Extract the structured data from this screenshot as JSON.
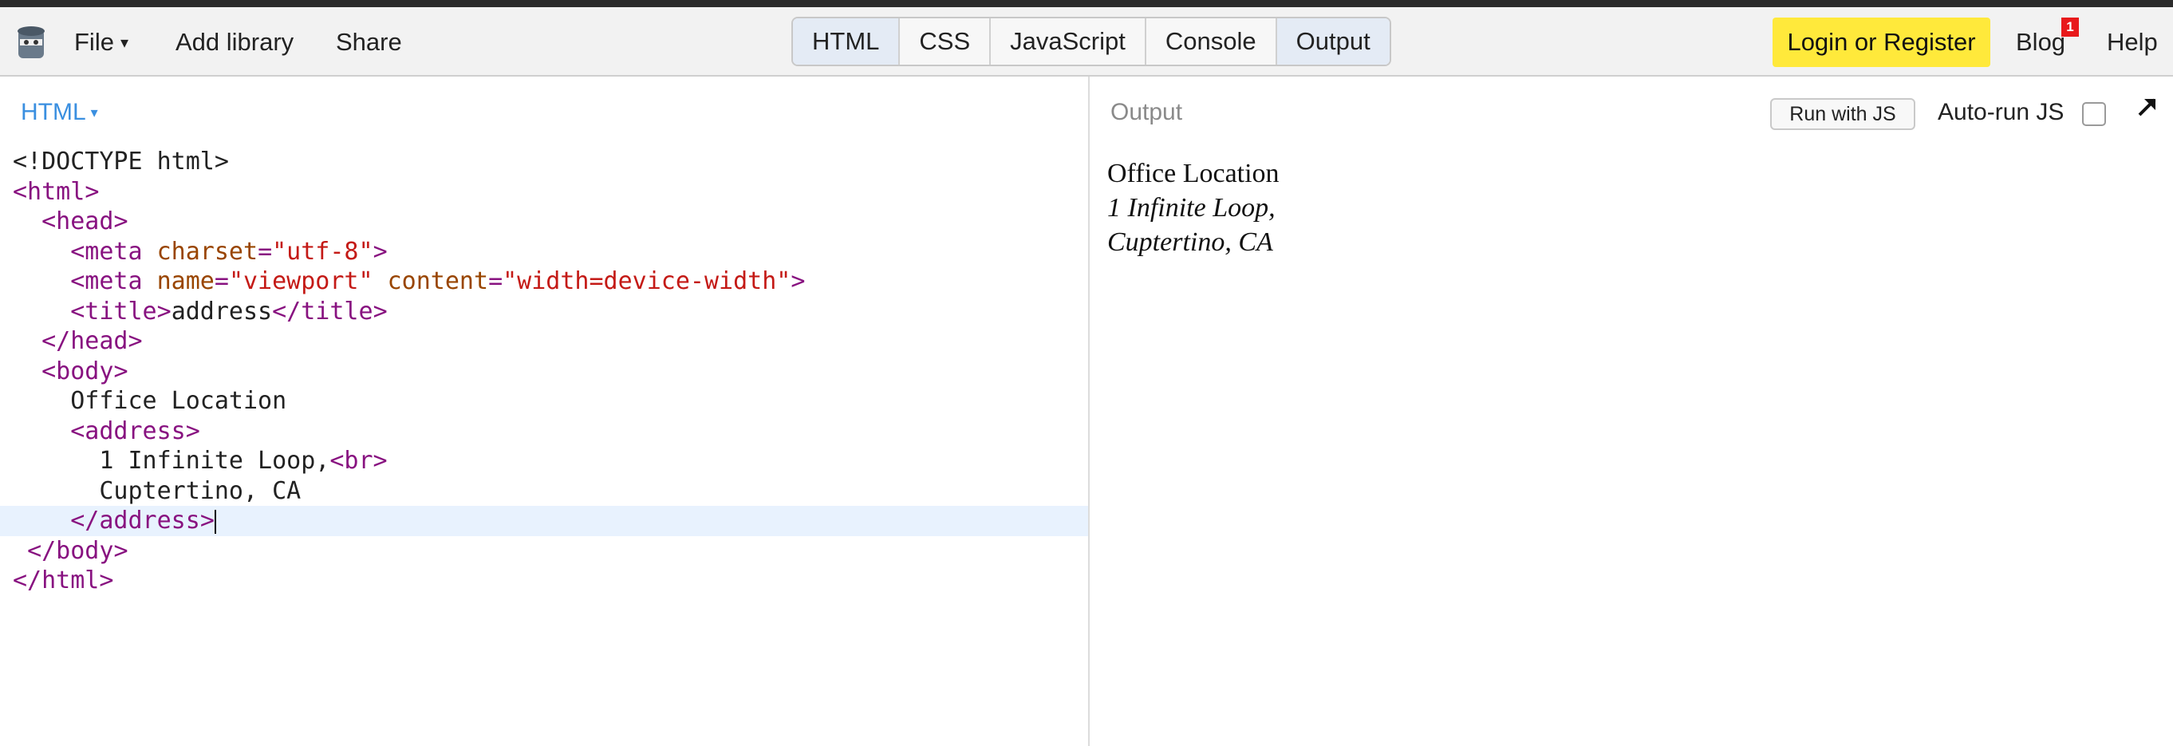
{
  "toolbar": {
    "menu": {
      "file": "File",
      "add_library": "Add library",
      "share": "Share"
    },
    "tabs": [
      "HTML",
      "CSS",
      "JavaScript",
      "Console",
      "Output"
    ],
    "login": "Login or Register",
    "blog": "Blog",
    "blog_badge": "1",
    "help": "Help"
  },
  "editor": {
    "panel_label": "HTML",
    "code_lines": [
      "<!DOCTYPE html>",
      "<html>",
      "  <head>",
      "    <meta charset=\"utf-8\">",
      "    <meta name=\"viewport\" content=\"width=device-width\">",
      "    <title>address</title>",
      "  </head>",
      "  <body>",
      "    Office Location",
      "    <address>",
      "      1 Infinite Loop,<br>",
      "      Cuptertino, CA",
      "    </address>",
      " </body>",
      "</html>"
    ]
  },
  "output": {
    "panel_label": "Output",
    "run_button": "Run with JS",
    "autorun_label": "Auto-run JS",
    "autorun_checked": false,
    "rendered": {
      "heading": "Office Location",
      "address_line1": "1 Infinite Loop,",
      "address_line2": "Cuptertino, CA"
    }
  },
  "colors": {
    "login_bg": "#ffe93b",
    "active_tab_bg": "#e4ebf5",
    "link_blue": "#3a8fe0",
    "badge_red": "#e8191b"
  }
}
